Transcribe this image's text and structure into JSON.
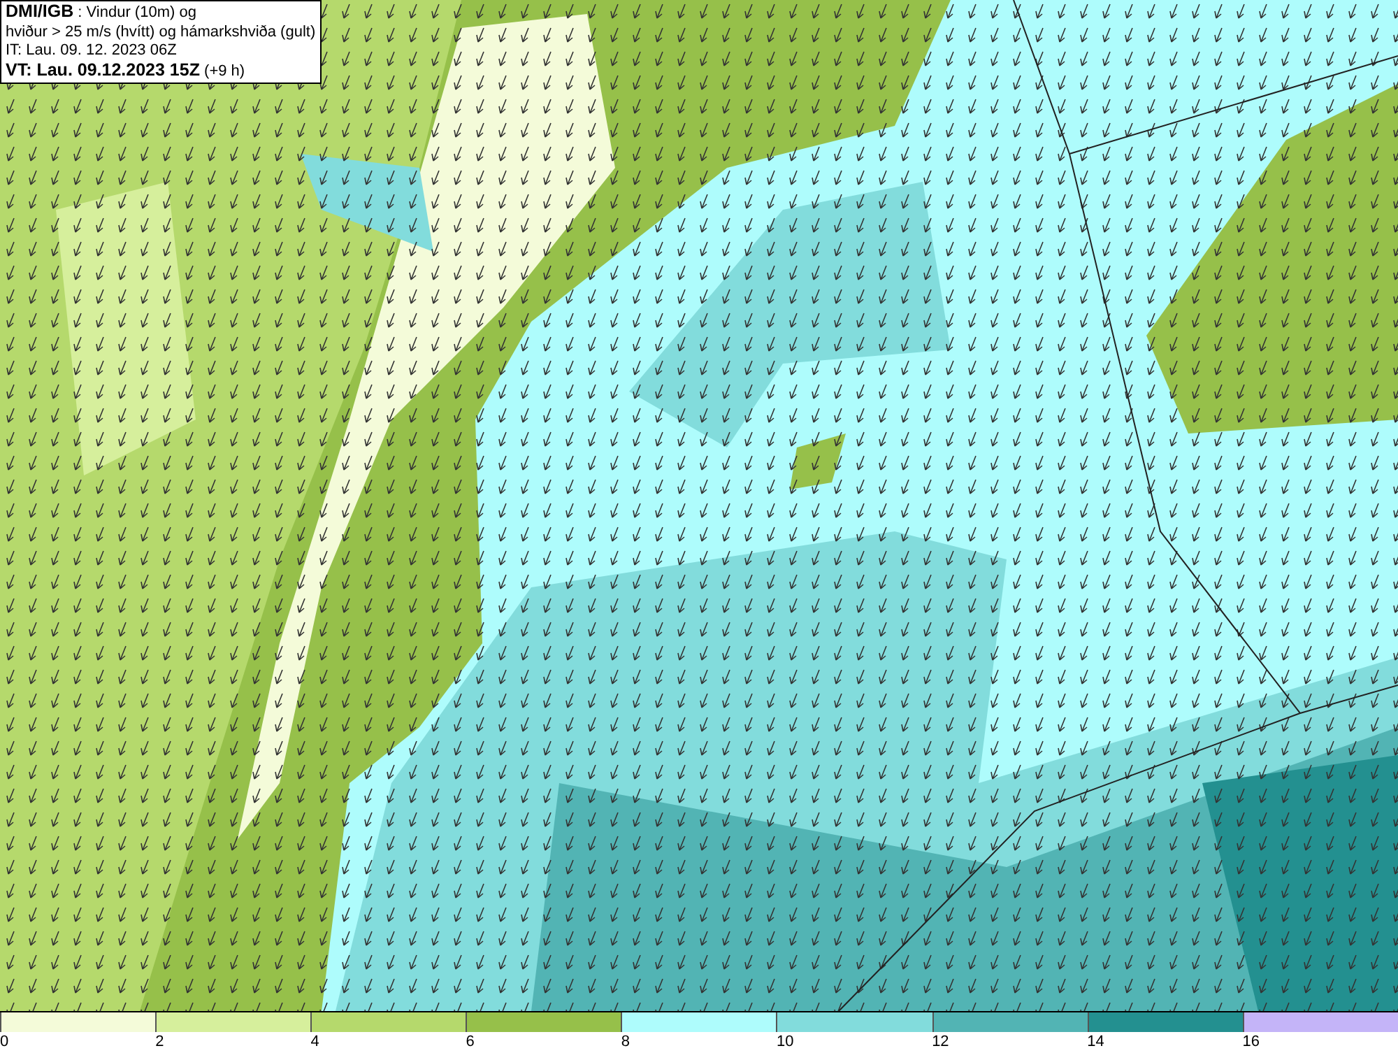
{
  "info_box": {
    "lines": [
      "**DMI/IGB** : Vindur (10m) og",
      "hviður > 25 m/s (hvítt) og hámarkshviða (gult)",
      "IT: Lau. 09. 12. 2023 06Z",
      "**VT: Lau. 09.12.2023 15Z** (+9 h)"
    ]
  },
  "legend": {
    "bins": [
      {
        "label": "0",
        "color": "#f4fbd9"
      },
      {
        "label": "2",
        "color": "#d6ef9c"
      },
      {
        "label": "4",
        "color": "#b5d96c"
      },
      {
        "label": "6",
        "color": "#96c04a"
      },
      {
        "label": "8",
        "color": "#aefcfc"
      },
      {
        "label": "10",
        "color": "#82dcdc"
      },
      {
        "label": "12",
        "color": "#52b4b4"
      },
      {
        "label": "14",
        "color": "#239090"
      },
      {
        "label": "16",
        "color": "#c4b4f8"
      }
    ]
  }
}
